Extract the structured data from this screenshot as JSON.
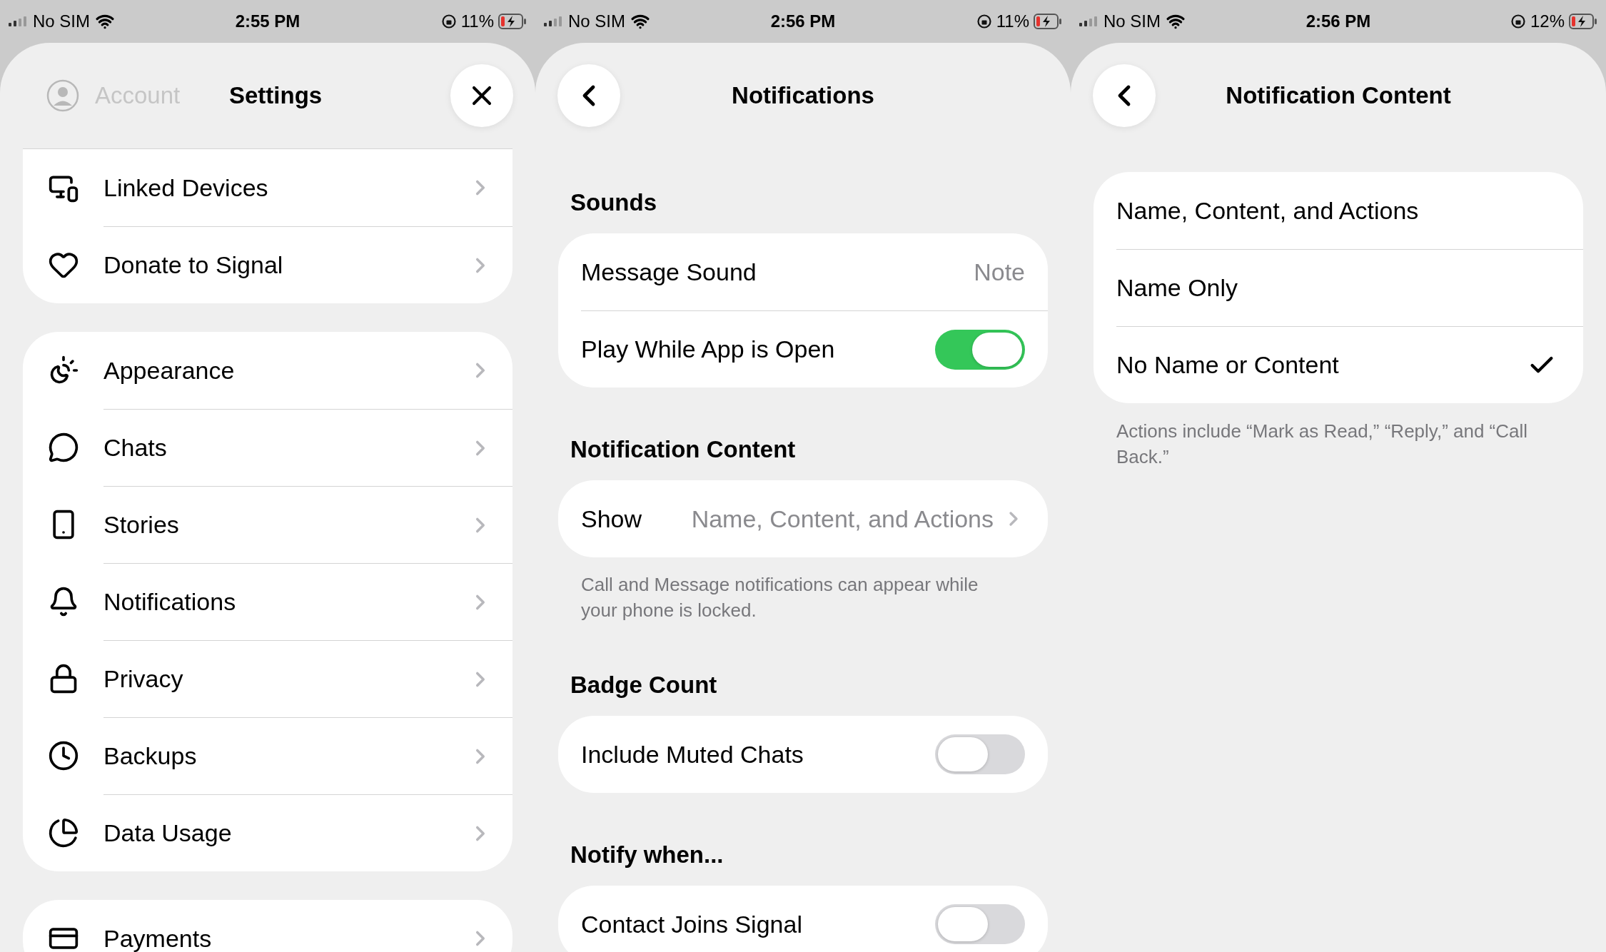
{
  "screens": [
    {
      "kind": "settings",
      "status_bar": {
        "carrier": "No SIM",
        "time": "2:55 PM",
        "battery": "11%"
      },
      "title": "Settings",
      "header_button": {
        "kind": "close"
      },
      "account_label": "Account",
      "groups": [
        {
          "items": [
            {
              "label": "Linked Devices"
            },
            {
              "label": "Donate to Signal"
            }
          ]
        },
        {
          "items": [
            {
              "label": "Appearance"
            },
            {
              "label": "Chats"
            },
            {
              "label": "Stories"
            },
            {
              "label": "Notifications"
            },
            {
              "label": "Privacy"
            },
            {
              "label": "Backups"
            },
            {
              "label": "Data Usage"
            }
          ]
        },
        {
          "items": [
            {
              "label": "Payments"
            }
          ]
        }
      ]
    },
    {
      "kind": "notifications",
      "status_bar": {
        "carrier": "No SIM",
        "time": "2:56 PM",
        "battery": "11%"
      },
      "title": "Notifications",
      "header_button": {
        "kind": "back"
      },
      "sections": [
        {
          "heading": "Sounds",
          "rows": [
            {
              "kind": "value",
              "label": "Message Sound",
              "value": "Note"
            },
            {
              "kind": "toggle",
              "label": "Play While App is Open",
              "on": true
            }
          ]
        },
        {
          "heading": "Notification Content",
          "rows": [
            {
              "kind": "link",
              "label": "Show",
              "value": "Name, Content, and Actions"
            }
          ],
          "footer": "Call and Message notifications can appear while your phone is locked."
        },
        {
          "heading": "Badge Count",
          "rows": [
            {
              "kind": "toggle",
              "label": "Include Muted Chats",
              "on": false
            }
          ]
        },
        {
          "heading": "Notify when...",
          "rows": [
            {
              "kind": "toggle",
              "label": "Contact Joins Signal",
              "on": false
            }
          ]
        }
      ]
    },
    {
      "kind": "options",
      "status_bar": {
        "carrier": "No SIM",
        "time": "2:56 PM",
        "battery": "12%"
      },
      "title": "Notification Content",
      "header_button": {
        "kind": "back"
      },
      "options": [
        {
          "label": "Name, Content, and Actions",
          "selected": false
        },
        {
          "label": "Name Only",
          "selected": false
        },
        {
          "label": "No Name or Content",
          "selected": true
        }
      ],
      "footer": "Actions include “Mark as Read,” “Reply,” and “Call Back.”"
    }
  ]
}
